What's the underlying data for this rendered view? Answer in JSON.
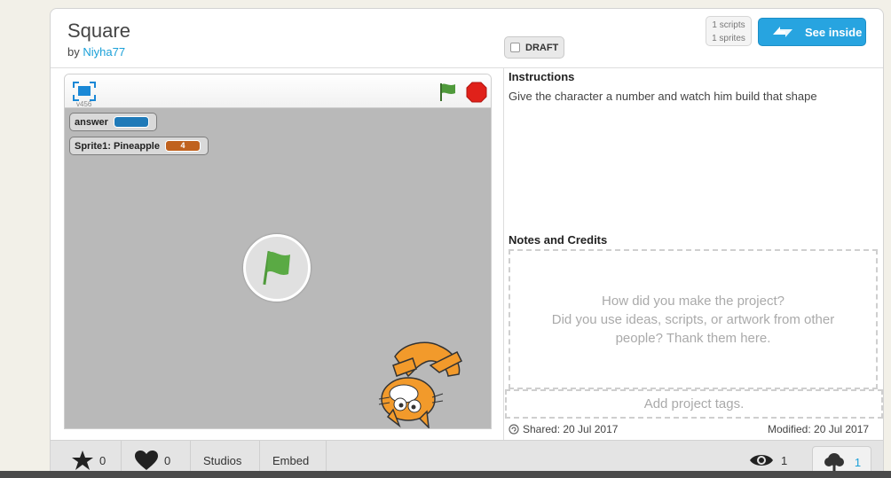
{
  "project": {
    "title": "Square",
    "by_prefix": "by",
    "author": "Niyha77",
    "draft_label": "DRAFT",
    "scripts_count": "1 scripts",
    "sprites_count": "1 sprites",
    "see_inside_label": "See inside"
  },
  "player": {
    "version": "v456",
    "monitors": [
      {
        "label": "answer",
        "value": "",
        "color": "#1f7ab8"
      },
      {
        "label": "Sprite1: Pineapple",
        "value": "4",
        "color": "#c0621e"
      }
    ]
  },
  "instructions": {
    "title": "Instructions",
    "text": "Give the character a number and watch him build that shape"
  },
  "notes": {
    "title": "Notes and Credits",
    "placeholder_line1": "How did you make the project?",
    "placeholder_line2": "Did you use ideas, scripts, or artwork from other",
    "placeholder_line3": "people? Thank them here."
  },
  "tags": {
    "placeholder": "Add project tags."
  },
  "dates": {
    "shared": "Shared: 20 Jul 2017",
    "modified": "Modified: 20 Jul 2017"
  },
  "footer": {
    "favorites": "0",
    "loves": "0",
    "studios_label": "Studios",
    "embed_label": "Embed",
    "views": "1",
    "remixes": "1"
  },
  "colors": {
    "accent": "#27a4e0",
    "link": "#1aa0d8",
    "flag_green": "#4f9a3b",
    "stop_red": "#e0211a"
  }
}
